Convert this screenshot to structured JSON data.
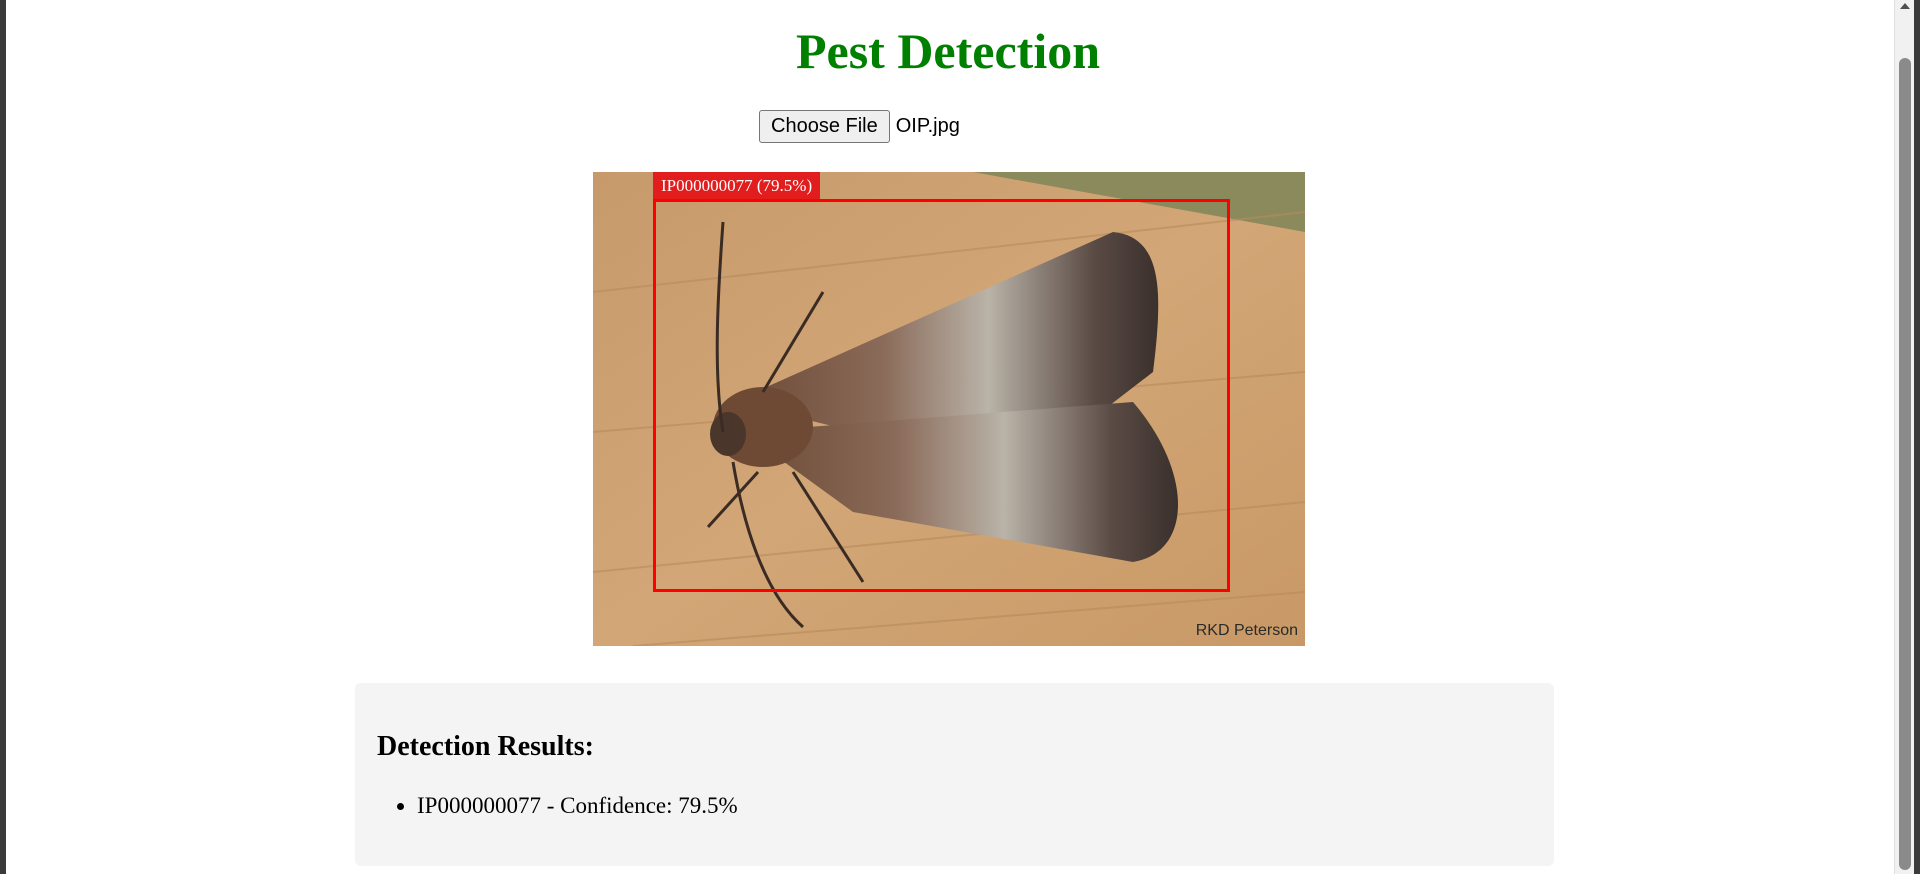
{
  "page": {
    "title": "Pest Detection",
    "title_color": "#008000"
  },
  "upload": {
    "button_label": "Choose File",
    "file_name": "OIP.jpg"
  },
  "image": {
    "credit": "RKD Peterson",
    "detection_label": "IP000000077 (79.5%)",
    "box_color": "#ff0000"
  },
  "results": {
    "heading": "Detection Results:",
    "items": [
      {
        "text": "IP000000077 - Confidence: 79.5%"
      }
    ]
  }
}
